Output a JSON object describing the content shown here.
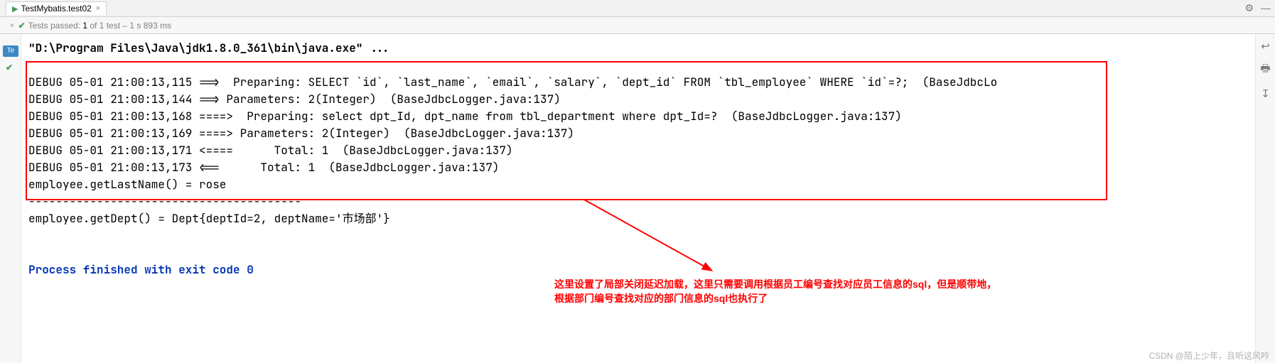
{
  "tab": {
    "title": "TestMybatis.test02",
    "close": "×"
  },
  "status": {
    "arrow": "»",
    "check": "✔",
    "label_prefix": "Tests passed: ",
    "passed_count": "1",
    "label_mid": " of 1 test",
    "time": " – 1 s 893 ms"
  },
  "left": {
    "badge": "Te",
    "check": "✔"
  },
  "right_icons": {
    "gear": "⚙",
    "minus": "—",
    "wrap": "↩",
    "print": "🖶",
    "down": "↧"
  },
  "console": {
    "cmd": "\"D:\\Program Files\\Java\\jdk1.8.0_361\\bin\\java.exe\" ...",
    "l1": "DEBUG 05-01 21:00:13,115 ==>  Preparing: SELECT `id`, `last_name`, `email`, `salary`, `dept_id` FROM `tbl_employee` WHERE `id`=?;  (BaseJdbcLo",
    "l2": "DEBUG 05-01 21:00:13,144 ==> Parameters: 2(Integer)  (BaseJdbcLogger.java:137)",
    "l3": "DEBUG 05-01 21:00:13,168 ====>  Preparing: select dpt_Id, dpt_name from tbl_department where dpt_Id=?  (BaseJdbcLogger.java:137)",
    "l4": "DEBUG 05-01 21:00:13,169 ====> Parameters: 2(Integer)  (BaseJdbcLogger.java:137)",
    "l5": "DEBUG 05-01 21:00:13,171 <====      Total: 1  (BaseJdbcLogger.java:137)",
    "l6": "DEBUG 05-01 21:00:13,173 <==      Total: 1  (BaseJdbcLogger.java:137)",
    "l7": "employee.getLastName() = rose",
    "l8": "----------------------------------------",
    "l9": "employee.getDept() = Dept{deptId=2, deptName='市场部'}",
    "lblank": " ",
    "lexit": "Process finished with exit code 0"
  },
  "annotation": {
    "line1": "这里设置了局部关闭延迟加载，这里只需要调用根据员工编号查找对应员工信息的sql，但是顺带地，",
    "line2": "根据部门编号查找对应的部门信息的sql也执行了"
  },
  "watermark": "CSDN @陌上少年，且听这风吟"
}
